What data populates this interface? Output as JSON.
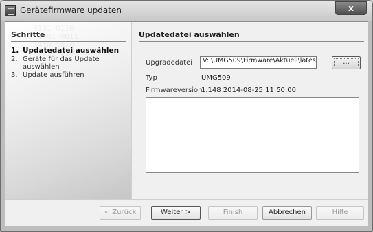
{
  "window": {
    "title": "Gerätefirmware updaten",
    "close_label": "x"
  },
  "sidebar": {
    "title": "Schritte",
    "steps": [
      {
        "num": "1.",
        "label": "Updatedatei auswählen"
      },
      {
        "num": "2.",
        "label": "Geräte für das Update auswählen"
      },
      {
        "num": "3.",
        "label": "Update ausführen"
      }
    ]
  },
  "main": {
    "title": "Updatedatei auswählen",
    "upgrade_label": "Upgradedatei",
    "upgrade_value": "V: \\UMG509\\Firmware\\Aktuell\\latest\\UMG",
    "browse_label": "...",
    "type_label": "Typ",
    "type_value": "UMG509",
    "fw_label": "Firmwareversion",
    "fw_value": "1.148 2014-08-25 11:50:00"
  },
  "footer": {
    "back": "< Zurück",
    "next": "Weiter >",
    "finish": "Finish",
    "cancel": "Abbrechen",
    "help": "Hilfe"
  }
}
